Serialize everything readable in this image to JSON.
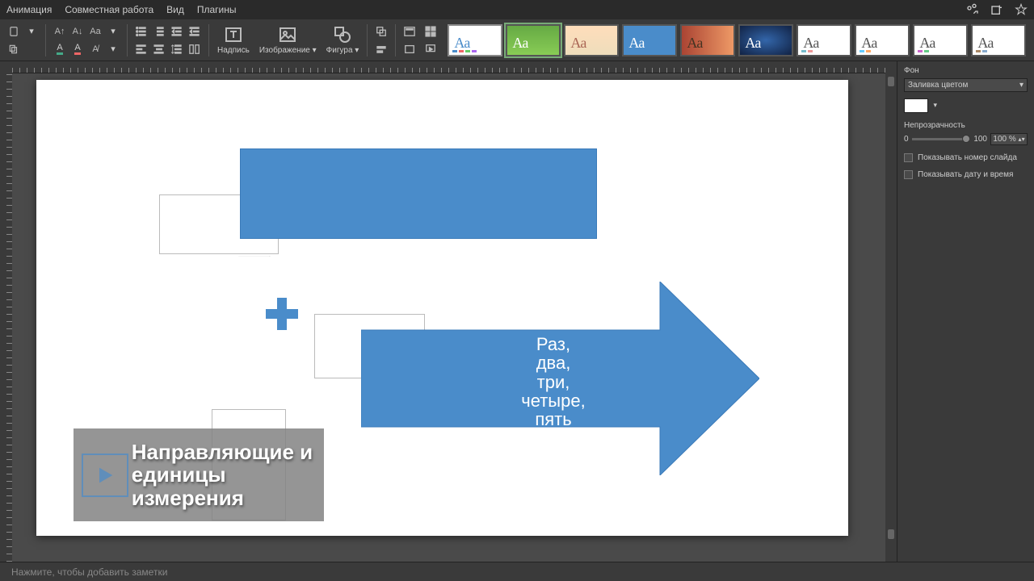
{
  "menu": {
    "items": [
      "Анимация",
      "Совместная работа",
      "Вид",
      "Плагины"
    ]
  },
  "toolbar": {
    "textbox": "Надпись",
    "image": "Изображение",
    "shape": "Фигура"
  },
  "themes": {
    "label": "Aa"
  },
  "arrow_text": {
    "line1": "Раз,",
    "line2": "два,",
    "line3": "три,",
    "line4": "четыре,",
    "line5": "пять"
  },
  "overlay": {
    "line1": "Направляющие и",
    "line2": "единицы измерения"
  },
  "right_panel": {
    "bg_title": "Фон",
    "fill_type": "Заливка цветом",
    "opacity_label": "Непрозрачность",
    "opacity_min": "0",
    "opacity_max": "100",
    "opacity_value": "100 %",
    "show_slide_num": "Показывать номер слайда",
    "show_datetime": "Показывать дату и время"
  },
  "notes": {
    "placeholder": "Нажмите, чтобы добавить заметки"
  }
}
